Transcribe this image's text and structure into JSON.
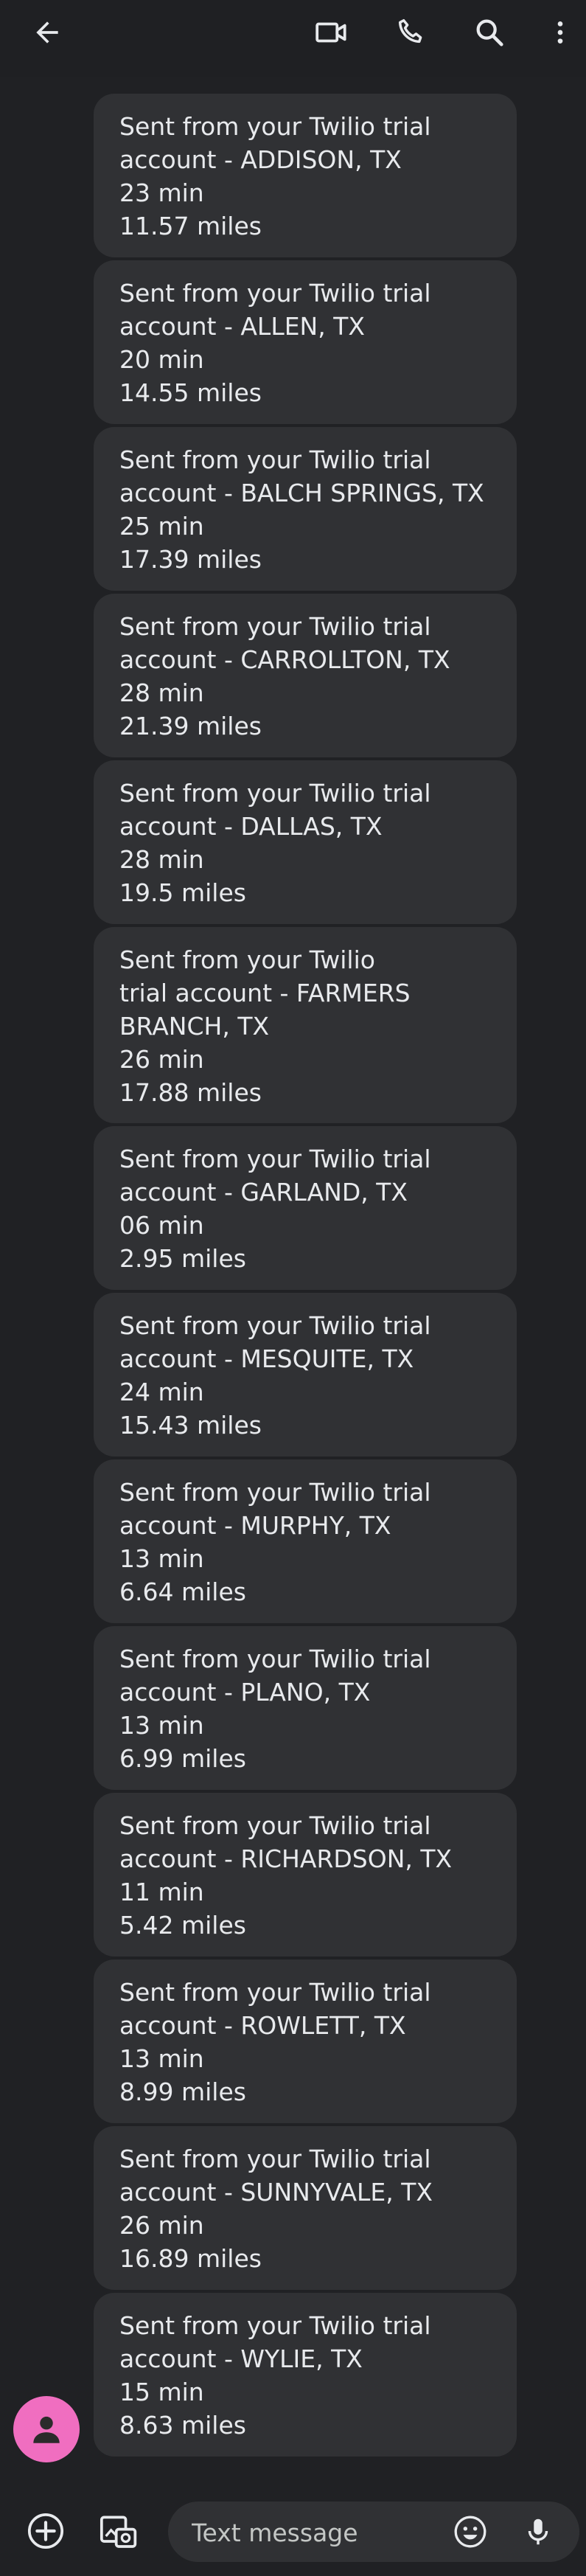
{
  "header": {
    "icons": [
      "back-arrow-icon",
      "video-call-icon",
      "phone-call-icon",
      "search-icon",
      "more-vert-icon"
    ]
  },
  "messages": [
    {
      "line1": "Sent from your Twilio trial",
      "line2": "account - ADDISON, TX",
      "line3": "23 min",
      "line4": "11.57 miles"
    },
    {
      "line1": "Sent from your Twilio trial",
      "line2": "account - ALLEN, TX",
      "line3": "20 min",
      "line4": "14.55 miles"
    },
    {
      "line1": "Sent from your Twilio trial",
      "line2": "account - BALCH SPRINGS, TX",
      "line3": "25 min",
      "line4": "17.39 miles"
    },
    {
      "line1": "Sent from your Twilio trial",
      "line2": "account - CARROLLTON, TX",
      "line3": "28 min",
      "line4": "21.39 miles"
    },
    {
      "line1": "Sent from your Twilio trial",
      "line2": "account - DALLAS, TX",
      "line3": "28 min",
      "line4": "19.5 miles"
    },
    {
      "line1": "Sent from your Twilio",
      "line2": "trial account - FARMERS",
      "line3": "BRANCH, TX",
      "line4": "26 min",
      "line5": "17.88 miles"
    },
    {
      "line1": "Sent from your Twilio trial",
      "line2": "account - GARLAND, TX",
      "line3": "06 min",
      "line4": "2.95 miles"
    },
    {
      "line1": "Sent from your Twilio trial",
      "line2": "account - MESQUITE, TX",
      "line3": "24 min",
      "line4": "15.43 miles"
    },
    {
      "line1": "Sent from your Twilio trial",
      "line2": "account - MURPHY, TX",
      "line3": "13 min",
      "line4": "6.64 miles"
    },
    {
      "line1": "Sent from your Twilio trial",
      "line2": "account - PLANO, TX",
      "line3": "13 min",
      "line4": "6.99 miles"
    },
    {
      "line1": "Sent from your Twilio trial",
      "line2": "account - RICHARDSON, TX",
      "line3": "11 min",
      "line4": "5.42 miles"
    },
    {
      "line1": "Sent from your Twilio trial",
      "line2": "account - ROWLETT, TX",
      "line3": "13 min",
      "line4": "8.99 miles"
    },
    {
      "line1": "Sent from your Twilio trial",
      "line2": "account - SUNNYVALE, TX",
      "line3": "26 min",
      "line4": "16.89 miles"
    },
    {
      "line1": "Sent from your Twilio trial",
      "line2": "account - WYLIE, TX",
      "line3": "15 min",
      "line4": "8.63 miles"
    }
  ],
  "avatar": {
    "icon": "person-icon",
    "color": "#f06ec0"
  },
  "compose": {
    "placeholder": "Text message",
    "icons": [
      "add-circle-icon",
      "gallery-icon",
      "emoji-icon",
      "mic-icon"
    ]
  },
  "colors": {
    "background": "#202124",
    "bubble": "#303134",
    "text": "#e8eaed",
    "accent_avatar": "#f06ec0"
  }
}
